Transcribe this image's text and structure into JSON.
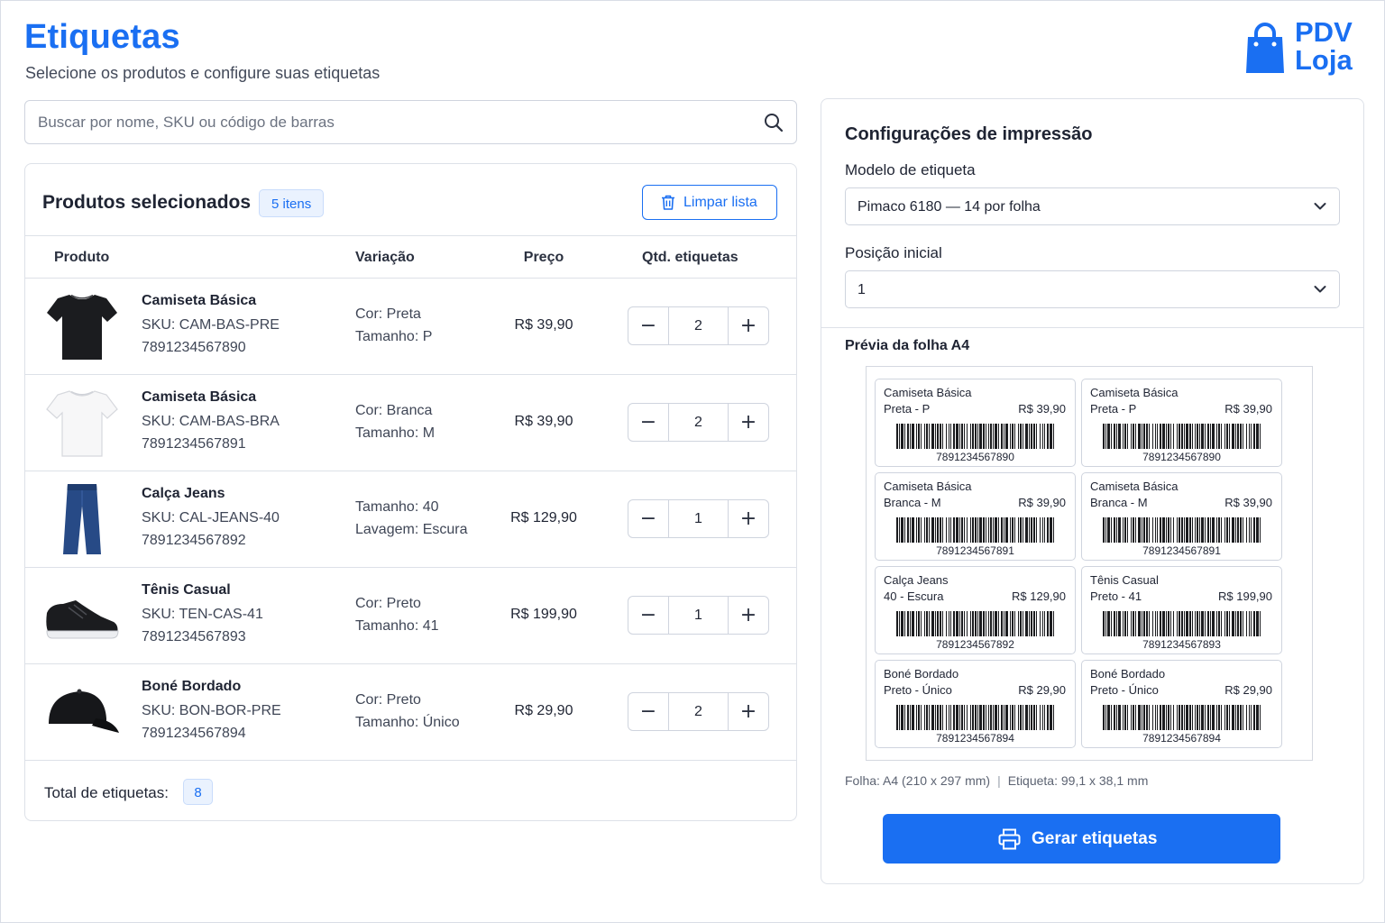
{
  "header": {
    "title": "Etiquetas",
    "subtitle": "Selecione os produtos e configure suas etiquetas",
    "logo_line1": "PDV",
    "logo_line2": "Loja",
    "brand_color": "#1a6ff2"
  },
  "search": {
    "placeholder": "Buscar por nome, SKU ou código de barras",
    "value": "",
    "icon": "search-icon"
  },
  "products": {
    "title": "Produtos selecionados",
    "count_badge": "5 itens",
    "clear_label": "Limpar lista",
    "columns": [
      "Produto",
      "Variação",
      "Preço",
      "Qtd. etiquetas"
    ],
    "rows": [
      {
        "name": "Camiseta Básica",
        "sku": "SKU: CAM-BAS-PRE",
        "barcode": "7891234567890",
        "variation_1": "Cor: Preta",
        "variation_2": "Tamanho: P",
        "price": "R$ 39,90",
        "qty": "2",
        "thumb": "tshirt-black"
      },
      {
        "name": "Camiseta Básica",
        "sku": "SKU: CAM-BAS-BRA",
        "barcode": "7891234567891",
        "variation_1": "Cor: Branca",
        "variation_2": "Tamanho: M",
        "price": "R$ 39,90",
        "qty": "2",
        "thumb": "tshirt-white"
      },
      {
        "name": "Calça Jeans",
        "sku": "SKU: CAL-JEANS-40",
        "barcode": "7891234567892",
        "variation_1": "Tamanho: 40",
        "variation_2": "Lavagem: Escura",
        "price": "R$ 129,90",
        "qty": "1",
        "thumb": "jeans"
      },
      {
        "name": "Tênis Casual",
        "sku": "SKU: TEN-CAS-41",
        "barcode": "7891234567893",
        "variation_1": "Cor: Preto",
        "variation_2": "Tamanho: 41",
        "price": "R$ 199,90",
        "qty": "1",
        "thumb": "sneaker"
      },
      {
        "name": "Boné Bordado",
        "sku": "SKU: BON-BOR-PRE",
        "barcode": "7891234567894",
        "variation_1": "Cor: Preto",
        "variation_2": "Tamanho: Único",
        "price": "R$ 29,90",
        "qty": "2",
        "thumb": "cap"
      }
    ],
    "total_label": "Total de etiquetas:",
    "total_value": "8"
  },
  "config": {
    "title": "Configurações de impressão",
    "model_label": "Modelo de etiqueta",
    "model_value": "Pimaco 6180 — 14 por folha",
    "position_label": "Posição inicial",
    "position_value": "1",
    "preview_title": "Prévia da folha A4",
    "labels": [
      {
        "name": "Camiseta Básica",
        "variant": "Preta - P",
        "price": "R$ 39,90",
        "code": "7891234567890"
      },
      {
        "name": "Camiseta Básica",
        "variant": "Preta - P",
        "price": "R$ 39,90",
        "code": "7891234567890"
      },
      {
        "name": "Camiseta Básica",
        "variant": "Branca - M",
        "price": "R$ 39,90",
        "code": "7891234567891"
      },
      {
        "name": "Camiseta Básica",
        "variant": "Branca - M",
        "price": "R$ 39,90",
        "code": "7891234567891"
      },
      {
        "name": "Calça Jeans",
        "variant": "40 - Escura",
        "price": "R$ 129,90",
        "code": "7891234567892"
      },
      {
        "name": "Tênis Casual",
        "variant": "Preto - 41",
        "price": "R$ 199,90",
        "code": "7891234567893"
      },
      {
        "name": "Boné Bordado",
        "variant": "Preto - Único",
        "price": "R$ 29,90",
        "code": "7891234567894"
      },
      {
        "name": "Boné Bordado",
        "variant": "Preto - Único",
        "price": "R$ 29,90",
        "code": "7891234567894"
      }
    ],
    "sheet_info_1": "Folha: A4 (210 x 297 mm)",
    "sheet_info_sep": "|",
    "sheet_info_2": "Etiqueta: 99,1 x 38,1 mm",
    "generate_label": "Gerar etiquetas"
  }
}
